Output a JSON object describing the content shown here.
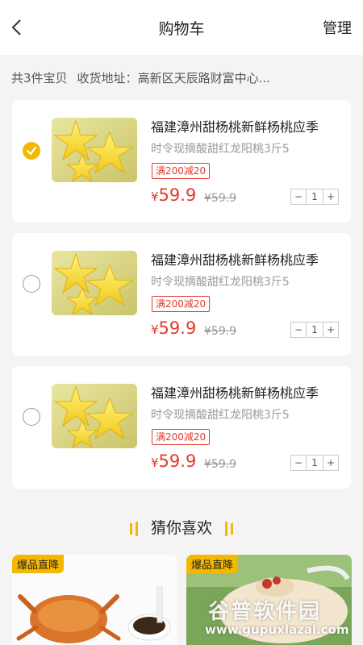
{
  "header": {
    "title": "购物车",
    "manage_label": "管理"
  },
  "summary": {
    "count_text": "共3件宝贝",
    "address_label": "收货地址：",
    "address_value": "高新区天辰路财富中心..."
  },
  "cart": {
    "items": [
      {
        "checked": true,
        "title": "福建漳州甜杨桃新鲜杨桃应季",
        "subtitle": "时令现摘酸甜红龙阳桃3斤5",
        "promo": "满200减20",
        "currency": "¥",
        "price": "59.9",
        "original_price": "¥59.9",
        "minus": "−",
        "quantity": "1",
        "plus": "+"
      },
      {
        "checked": false,
        "title": "福建漳州甜杨桃新鲜杨桃应季",
        "subtitle": "时令现摘酸甜红龙阳桃3斤5",
        "promo": "满200减20",
        "currency": "¥",
        "price": "59.9",
        "original_price": "¥59.9",
        "minus": "−",
        "quantity": "1",
        "plus": "+"
      },
      {
        "checked": false,
        "title": "福建漳州甜杨桃新鲜杨桃应季",
        "subtitle": "时令现摘酸甜红龙阳桃3斤5",
        "promo": "满200减20",
        "currency": "¥",
        "price": "59.9",
        "original_price": "¥59.9",
        "minus": "−",
        "quantity": "1",
        "plus": "+"
      }
    ]
  },
  "recommend": {
    "title": "猜你喜欢",
    "cards": [
      {
        "badge": "爆品直降"
      },
      {
        "badge": "爆品直降"
      }
    ]
  },
  "watermark": {
    "brand": "谷普软件园",
    "url": "www.gupuxlazal.com"
  },
  "colors": {
    "accent": "#f5b800",
    "price_red": "#e23b2a"
  },
  "icons": {
    "back": "chevron-left-icon",
    "check": "checkmark-icon"
  }
}
